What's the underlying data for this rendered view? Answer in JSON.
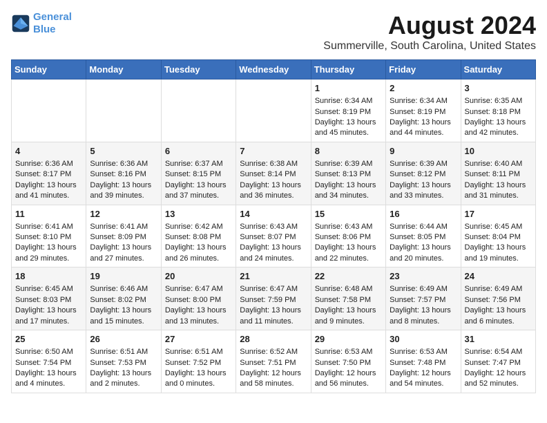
{
  "header": {
    "logo_line1": "General",
    "logo_line2": "Blue",
    "title": "August 2024",
    "subtitle": "Summerville, South Carolina, United States"
  },
  "days_of_week": [
    "Sunday",
    "Monday",
    "Tuesday",
    "Wednesday",
    "Thursday",
    "Friday",
    "Saturday"
  ],
  "weeks": [
    [
      {
        "day": "",
        "content": ""
      },
      {
        "day": "",
        "content": ""
      },
      {
        "day": "",
        "content": ""
      },
      {
        "day": "",
        "content": ""
      },
      {
        "day": "1",
        "content": "Sunrise: 6:34 AM\nSunset: 8:19 PM\nDaylight: 13 hours and 45 minutes."
      },
      {
        "day": "2",
        "content": "Sunrise: 6:34 AM\nSunset: 8:19 PM\nDaylight: 13 hours and 44 minutes."
      },
      {
        "day": "3",
        "content": "Sunrise: 6:35 AM\nSunset: 8:18 PM\nDaylight: 13 hours and 42 minutes."
      }
    ],
    [
      {
        "day": "4",
        "content": "Sunrise: 6:36 AM\nSunset: 8:17 PM\nDaylight: 13 hours and 41 minutes."
      },
      {
        "day": "5",
        "content": "Sunrise: 6:36 AM\nSunset: 8:16 PM\nDaylight: 13 hours and 39 minutes."
      },
      {
        "day": "6",
        "content": "Sunrise: 6:37 AM\nSunset: 8:15 PM\nDaylight: 13 hours and 37 minutes."
      },
      {
        "day": "7",
        "content": "Sunrise: 6:38 AM\nSunset: 8:14 PM\nDaylight: 13 hours and 36 minutes."
      },
      {
        "day": "8",
        "content": "Sunrise: 6:39 AM\nSunset: 8:13 PM\nDaylight: 13 hours and 34 minutes."
      },
      {
        "day": "9",
        "content": "Sunrise: 6:39 AM\nSunset: 8:12 PM\nDaylight: 13 hours and 33 minutes."
      },
      {
        "day": "10",
        "content": "Sunrise: 6:40 AM\nSunset: 8:11 PM\nDaylight: 13 hours and 31 minutes."
      }
    ],
    [
      {
        "day": "11",
        "content": "Sunrise: 6:41 AM\nSunset: 8:10 PM\nDaylight: 13 hours and 29 minutes."
      },
      {
        "day": "12",
        "content": "Sunrise: 6:41 AM\nSunset: 8:09 PM\nDaylight: 13 hours and 27 minutes."
      },
      {
        "day": "13",
        "content": "Sunrise: 6:42 AM\nSunset: 8:08 PM\nDaylight: 13 hours and 26 minutes."
      },
      {
        "day": "14",
        "content": "Sunrise: 6:43 AM\nSunset: 8:07 PM\nDaylight: 13 hours and 24 minutes."
      },
      {
        "day": "15",
        "content": "Sunrise: 6:43 AM\nSunset: 8:06 PM\nDaylight: 13 hours and 22 minutes."
      },
      {
        "day": "16",
        "content": "Sunrise: 6:44 AM\nSunset: 8:05 PM\nDaylight: 13 hours and 20 minutes."
      },
      {
        "day": "17",
        "content": "Sunrise: 6:45 AM\nSunset: 8:04 PM\nDaylight: 13 hours and 19 minutes."
      }
    ],
    [
      {
        "day": "18",
        "content": "Sunrise: 6:45 AM\nSunset: 8:03 PM\nDaylight: 13 hours and 17 minutes."
      },
      {
        "day": "19",
        "content": "Sunrise: 6:46 AM\nSunset: 8:02 PM\nDaylight: 13 hours and 15 minutes."
      },
      {
        "day": "20",
        "content": "Sunrise: 6:47 AM\nSunset: 8:00 PM\nDaylight: 13 hours and 13 minutes."
      },
      {
        "day": "21",
        "content": "Sunrise: 6:47 AM\nSunset: 7:59 PM\nDaylight: 13 hours and 11 minutes."
      },
      {
        "day": "22",
        "content": "Sunrise: 6:48 AM\nSunset: 7:58 PM\nDaylight: 13 hours and 9 minutes."
      },
      {
        "day": "23",
        "content": "Sunrise: 6:49 AM\nSunset: 7:57 PM\nDaylight: 13 hours and 8 minutes."
      },
      {
        "day": "24",
        "content": "Sunrise: 6:49 AM\nSunset: 7:56 PM\nDaylight: 13 hours and 6 minutes."
      }
    ],
    [
      {
        "day": "25",
        "content": "Sunrise: 6:50 AM\nSunset: 7:54 PM\nDaylight: 13 hours and 4 minutes."
      },
      {
        "day": "26",
        "content": "Sunrise: 6:51 AM\nSunset: 7:53 PM\nDaylight: 13 hours and 2 minutes."
      },
      {
        "day": "27",
        "content": "Sunrise: 6:51 AM\nSunset: 7:52 PM\nDaylight: 13 hours and 0 minutes."
      },
      {
        "day": "28",
        "content": "Sunrise: 6:52 AM\nSunset: 7:51 PM\nDaylight: 12 hours and 58 minutes."
      },
      {
        "day": "29",
        "content": "Sunrise: 6:53 AM\nSunset: 7:50 PM\nDaylight: 12 hours and 56 minutes."
      },
      {
        "day": "30",
        "content": "Sunrise: 6:53 AM\nSunset: 7:48 PM\nDaylight: 12 hours and 54 minutes."
      },
      {
        "day": "31",
        "content": "Sunrise: 6:54 AM\nSunset: 7:47 PM\nDaylight: 12 hours and 52 minutes."
      }
    ]
  ]
}
